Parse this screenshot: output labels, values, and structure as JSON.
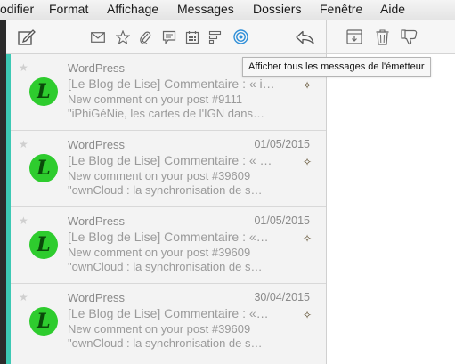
{
  "menubar": {
    "items": [
      "odifier",
      "Format",
      "Affichage",
      "Messages",
      "Dossiers",
      "Fenêtre",
      "Aide"
    ]
  },
  "toolbar": {
    "icons": [
      "compose-icon",
      "envelope-icon",
      "star-icon",
      "paperclip-icon",
      "speech-bubble-icon",
      "calendar-icon",
      "sort-icon",
      "target-icon",
      "reply-icon",
      "archive-icon",
      "trash-icon",
      "junk-icon"
    ],
    "accent_color": "#2f8fd8"
  },
  "tooltip": {
    "text": "Afficher tous les messages de l'émetteur"
  },
  "messages": [
    {
      "from": "WordPress",
      "date": "",
      "subject": "[Le Blog de Lise] Commentaire : « i…",
      "line1": "New comment on your post #9111",
      "line2": "\"iPhiGéNie, les cartes de l'IGN dans…"
    },
    {
      "from": "WordPress",
      "date": "01/05/2015",
      "subject": "[Le Blog de Lise] Commentaire : « …",
      "line1": "New comment on your post #39609",
      "line2": "\"ownCloud : la synchronisation de s…"
    },
    {
      "from": "WordPress",
      "date": "01/05/2015",
      "subject": "[Le Blog de Lise] Commentaire : «…",
      "line1": "New comment on your post #39609",
      "line2": "\"ownCloud : la synchronisation de s…"
    },
    {
      "from": "WordPress",
      "date": "30/04/2015",
      "subject": "[Le Blog de Lise] Commentaire : «…",
      "line1": "New comment on your post #39609",
      "line2": "\"ownCloud : la synchronisation de s…"
    }
  ],
  "avatar_letter": "L",
  "colors": {
    "selection_bar": "#3cc9b4",
    "avatar_bg": "#2ecc2e"
  }
}
